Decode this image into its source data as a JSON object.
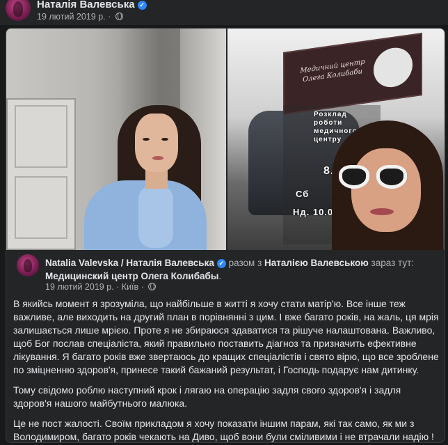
{
  "post": {
    "author": "Наталія Валевська",
    "date": "19 лютий 2019 р.",
    "separator": "·"
  },
  "shared": {
    "author": "Natalia Valevska / Наталія Валевська",
    "with_prefix": "разом з",
    "with_name": "Наталією Валевською",
    "place_prefix": "зараз тут:",
    "place": "Медицинский центр Олега Колибабы",
    "place_suffix": ".",
    "date": "19 лютий 2019 р.",
    "location": "Київ",
    "separator": "·"
  },
  "photo_sign": {
    "line1": "Медичний центр",
    "line2": "Олега Колибаби",
    "hours_title": "Розклад роботи медичного центру",
    "hours_time": "8.30",
    "hours_sat": "Сб",
    "hours_sun": "Нд. 10.00"
  },
  "body": {
    "p1": "В якийсь момент я зрозуміла, що найбільше в житті я хочу стати матір'ю. Все інше теж важливе, але виходить на другий план в порівнянні з цим. І вже багато років, на жаль, ця мрія залишається лише мрією. Проте я не збираюся здаватися та рішуче налаштована. Важливо, щоб Бог послав спеціаліста, який правильно поставить діагноз та призначить ефективне лікування. Я багато років вже звертаюсь до кращих спеціалістів і свято вірю, що все зроблене по зміцненню здоров'я, принесе такий бажаний результат, і Господь подарує нам дитинку.",
    "p2": "Тому свідомо роблю наступний крок і лягаю на операцію задля свого здоров'я і задля здоров'я нашого майбутнього малюка.",
    "p3": "Це не пост жалості. Своїм прикладом я хочу показати іншим парам, які так само, як ми з Володимиром, багато років чекають на Диво, щоб вони були сміливими і не втрачали надію ! З Богом ! ! !",
    "emojis": "🙏🙏🙏"
  }
}
